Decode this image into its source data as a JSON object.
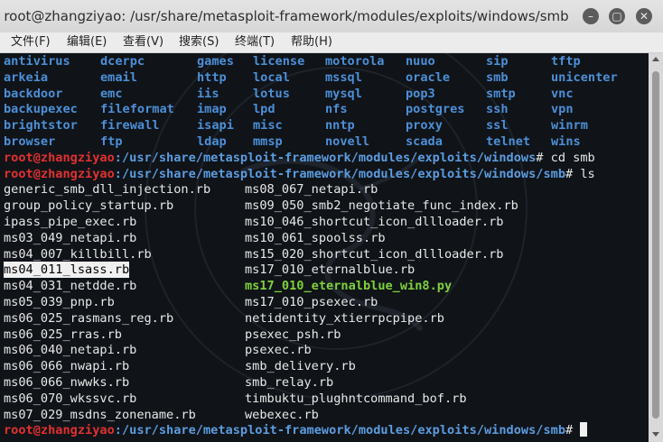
{
  "window": {
    "title": "root@zhangziyao: /usr/share/metasploit-framework/modules/exploits/windows/smb",
    "min_glyph": "–",
    "max_glyph": "▢",
    "close_glyph": "✕"
  },
  "menu": {
    "items": [
      "文件(F)",
      "编辑(E)",
      "查看(V)",
      "搜索(S)",
      "终端(T)",
      "帮助(H)"
    ]
  },
  "terminal": {
    "dir_rows": [
      [
        "antivirus",
        "dcerpc",
        "games",
        "license",
        "motorola",
        "nuuo",
        "sip",
        "tftp"
      ],
      [
        "arkeia",
        "email",
        "http",
        "local",
        "mssql",
        "oracle",
        "smb",
        "unicenter"
      ],
      [
        "backdoor",
        "emc",
        "iis",
        "lotus",
        "mysql",
        "pop3",
        "smtp",
        "vnc"
      ],
      [
        "backupexec",
        "fileformat",
        "imap",
        "lpd",
        "nfs",
        "postgres",
        "ssh",
        "vpn"
      ],
      [
        "brightstor",
        "firewall",
        "isapi",
        "misc",
        "nntp",
        "proxy",
        "ssl",
        "winrm"
      ],
      [
        "browser",
        "ftp",
        "ldap",
        "mmsp",
        "novell",
        "scada",
        "telnet",
        "wins"
      ]
    ],
    "prompt_user": "root@zhangziyao",
    "prompt_path_1": ":/usr/share/metasploit-framework/modules/exploits/windows",
    "cmd_1": "# cd smb",
    "prompt_path_2": ":/usr/share/metasploit-framework/modules/exploits/windows/smb",
    "cmd_2": "# ls",
    "cmd_3": "# ",
    "files_left": [
      "generic_smb_dll_injection.rb",
      "group_policy_startup.rb",
      "ipass_pipe_exec.rb",
      "ms03_049_netapi.rb",
      "ms04_007_killbill.rb",
      "ms04_011_lsass.rb",
      "ms04_031_netdde.rb",
      "ms05_039_pnp.rb",
      "ms06_025_rasmans_reg.rb",
      "ms06_025_rras.rb",
      "ms06_040_netapi.rb",
      "ms06_066_nwapi.rb",
      "ms06_066_nwwks.rb",
      "ms06_070_wkssvc.rb",
      "ms07_029_msdns_zonename.rb"
    ],
    "files_right": [
      "ms08_067_netapi.rb",
      "ms09_050_smb2_negotiate_func_index.rb",
      "ms10_046_shortcut_icon_dllloader.rb",
      "ms10_061_spoolss.rb",
      "ms15_020_shortcut_icon_dllloader.rb",
      "ms17_010_eternalblue.rb",
      "ms17_010_eternalblue_win8.py",
      "ms17_010_psexec.rb",
      "netidentity_xtierrpcpipe.rb",
      "psexec_psh.rb",
      "psexec.rb",
      "smb_delivery.rb",
      "smb_relay.rb",
      "timbuktu_plughntcommand_bof.rb",
      "webexec.rb"
    ]
  }
}
